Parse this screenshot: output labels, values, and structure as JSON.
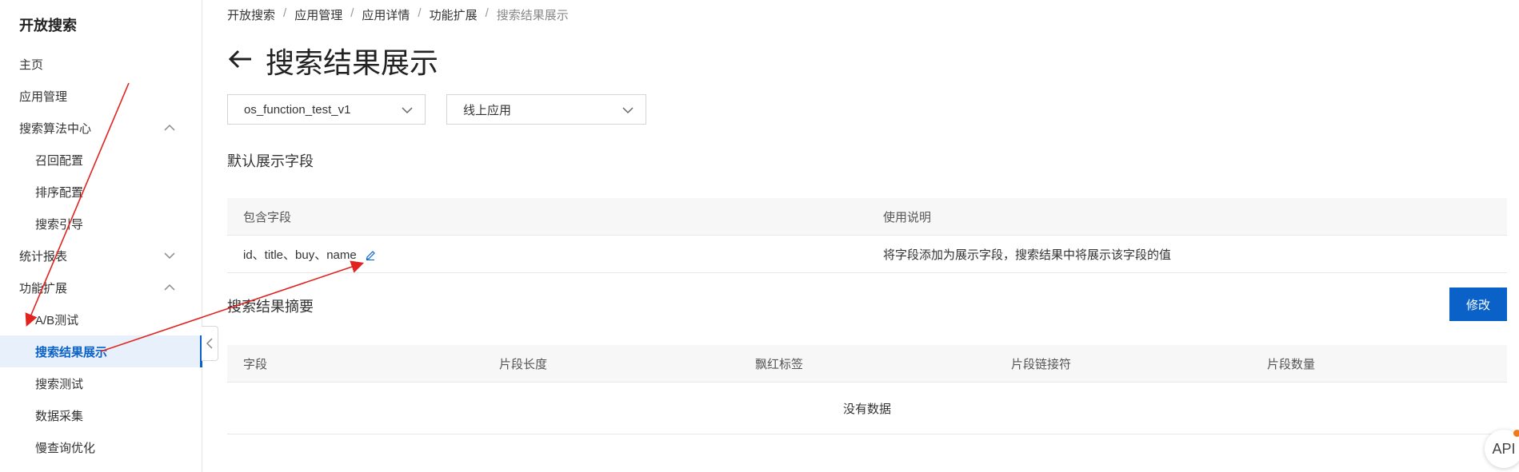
{
  "sidebar": {
    "brand": "开放搜索",
    "items": [
      {
        "label": "主页"
      },
      {
        "label": "应用管理"
      },
      {
        "label": "搜索算法中心"
      },
      {
        "label": "召回配置"
      },
      {
        "label": "排序配置"
      },
      {
        "label": "搜索引导"
      },
      {
        "label": "统计报表"
      },
      {
        "label": "功能扩展"
      },
      {
        "label": "A/B测试"
      },
      {
        "label": "搜索结果展示"
      },
      {
        "label": "搜索测试"
      },
      {
        "label": "数据采集"
      },
      {
        "label": "慢查询优化"
      }
    ]
  },
  "breadcrumb": [
    "开放搜索",
    "应用管理",
    "应用详情",
    "功能扩展",
    "搜索结果展示"
  ],
  "breadcrumb_sep": "/",
  "page_title": "搜索结果展示",
  "selects": {
    "app": "os_function_test_v1",
    "env": "线上应用"
  },
  "default_fields": {
    "title": "默认展示字段",
    "headers": [
      "包含字段",
      "使用说明"
    ],
    "row": {
      "fields": "id、title、buy、name",
      "desc": "将字段添加为展示字段，搜索结果中将展示该字段的值"
    }
  },
  "summary": {
    "title": "搜索结果摘要",
    "button": "修改",
    "headers": [
      "字段",
      "片段长度",
      "飘红标签",
      "片段链接符",
      "片段数量"
    ],
    "empty": "没有数据"
  },
  "api_badge": "API",
  "colors": {
    "accent": "#0a62c9",
    "annotation": "#e0231f"
  }
}
